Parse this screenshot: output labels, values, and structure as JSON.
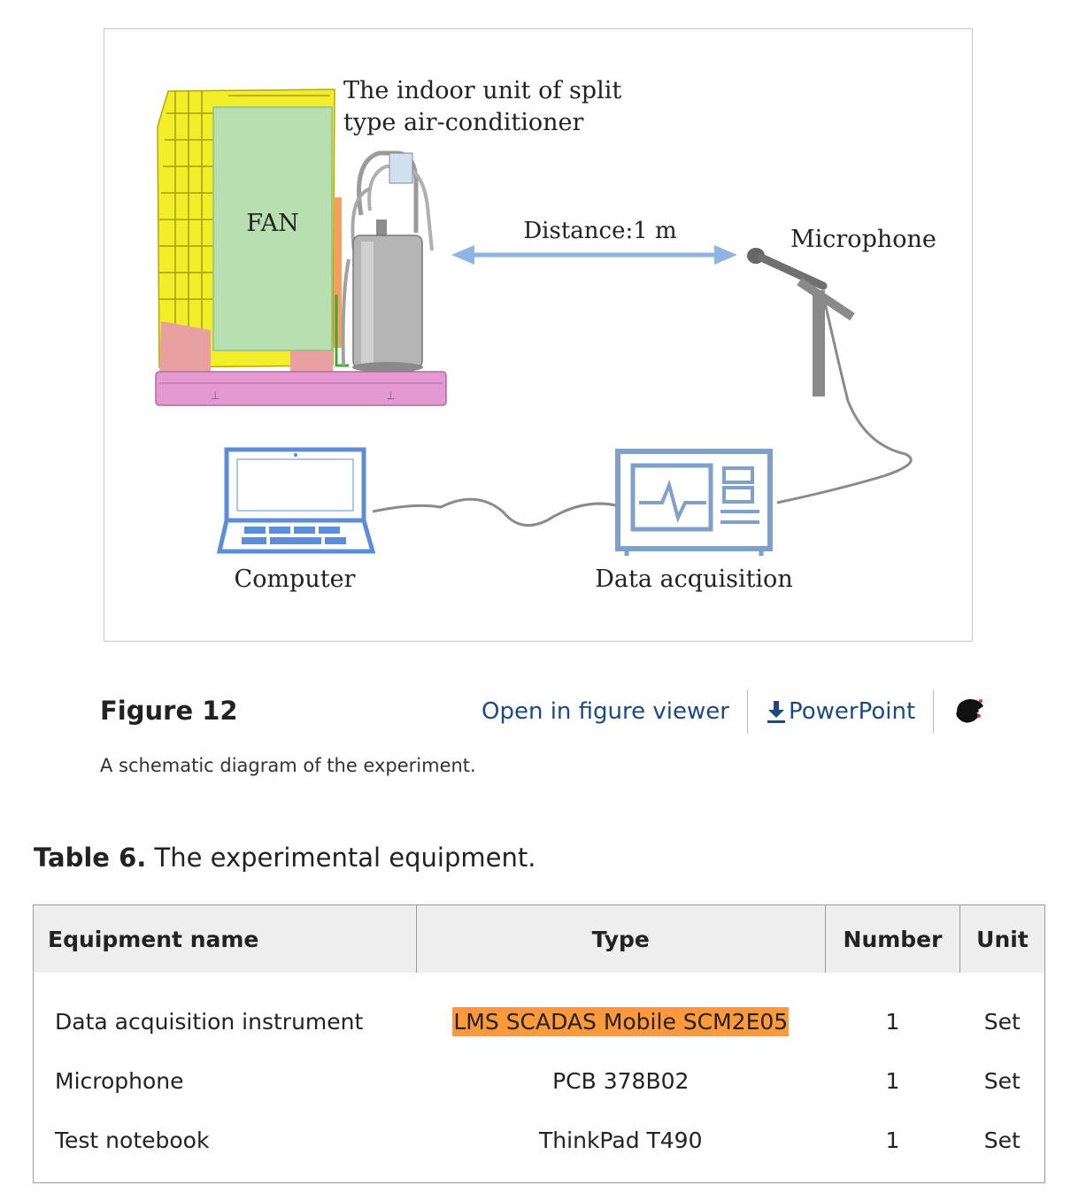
{
  "figure": {
    "diagram_labels": {
      "unit_line1": "The indoor unit of split",
      "unit_line2": "type air-conditioner",
      "fan": "FAN",
      "distance": "Distance:1 m",
      "microphone": "Microphone",
      "computer": "Computer",
      "data_acquisition": "Data acquisition"
    },
    "label": "Figure 12",
    "actions": {
      "open_viewer": "Open in figure viewer",
      "powerpoint": "PowerPoint"
    },
    "caption": "A schematic diagram of the experiment."
  },
  "table": {
    "title_bold": "Table 6.",
    "title_rest": " The experimental equipment.",
    "headers": [
      "Equipment name",
      "Type",
      "Number",
      "Unit"
    ],
    "rows": [
      [
        "Data acquisition instrument",
        "LMS SCADAS Mobile SCM2E05",
        "1",
        "Set"
      ],
      [
        "Microphone",
        "PCB 378B02",
        "1",
        "Set"
      ],
      [
        "Test notebook",
        "ThinkPad T490",
        "1",
        "Set"
      ]
    ],
    "highlight_color": "#ff9a3c"
  },
  "colors": {
    "link": "#1c4a7e",
    "diagram_blue": "#5b8ed6",
    "arrow_blue": "#8fb4e3",
    "coil_yellow": "#f2ee2a",
    "fan_green": "#b7dfb0",
    "base_pink": "#e39ad0"
  },
  "icons": [
    "download-icon",
    "share-icon"
  ]
}
